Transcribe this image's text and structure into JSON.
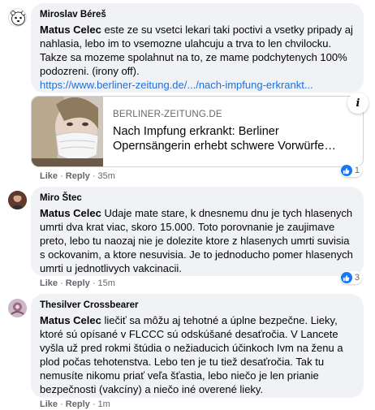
{
  "comments": [
    {
      "author": "Miroslav Béreš",
      "mention": "",
      "text": "Matus Celec este ze su vsetci lekari taki poctivi a vsetky pripady aj nahlasia, lebo im to vsemozne ulahcuju a trva to len chvilocku. Takze sa mozeme spolahnut na to, ze mame podchytenych 100% podozreni. (irony off).",
      "link": "https://www.berliner-zeitung.de/.../nach-impfung-erkrankt...",
      "preview": {
        "domain": "BERLINER-ZEITUNG.DE",
        "headline": "Nach Impfung erkrankt: Berliner Opernsängerin erhebt schwere Vorwürfe…",
        "info_icon": "i"
      },
      "actions": {
        "like": "Like",
        "reply": "Reply",
        "time": "35m"
      },
      "reaction_count": "1"
    },
    {
      "author": "Miro Štec",
      "mention": "Matus Celec",
      "text": " Udaje mate stare, k dnesnemu dnu je tych hlasenych umrti dva krat viac, skoro 15.000. Toto porovnanie je zaujimave preto, lebo tu naozaj nie je dolezite ktore z hlasenych umrti suvisia s ockovanim, a ktore nesuvisia. Je to jednoducho pomer hlasenych umrti u jednotlivych vakcinacii.",
      "actions": {
        "like": "Like",
        "reply": "Reply",
        "time": "15m"
      },
      "reaction_count": "3"
    },
    {
      "author": "Thesilver Crossbearer",
      "mention": "Matus Celec",
      "text": " liečiť sa môžu aj tehotné a úplne bezpečne. Lieky, ktoré sú opísané v FLCCC sú odskúšané desaťročia. V Lancete vyšla už pred rokmi štúdia o nežiaducich účinkoch Ivm na ženu a plod počas tehotenstva. Lebo ten je tu tiež desaťročia. Tak tu nemusíte nikomu priať veľa šťastia, lebo niečo je len prianie bezpečnosti (vakcíny) a niečo iné overené lieky.",
      "actions": {
        "like": "Like",
        "reply": "Reply",
        "time": "1m"
      }
    }
  ],
  "icons": {
    "like": "thumbs-up-icon",
    "info": "info-icon"
  },
  "colors": {
    "bubble": "#f0f2f5",
    "link": "#216fdb",
    "meta": "#65676b",
    "like_blue": "#1877f2"
  }
}
